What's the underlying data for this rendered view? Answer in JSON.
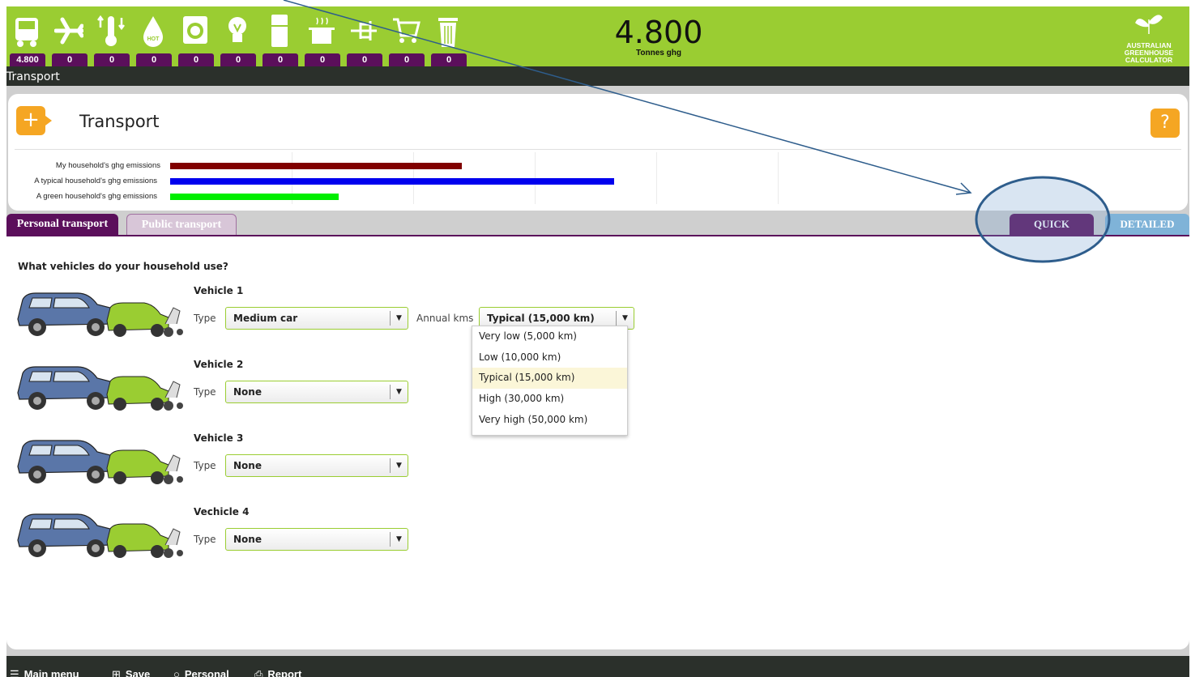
{
  "header": {
    "categories": [
      {
        "name": "transport",
        "value": "4.800"
      },
      {
        "name": "air-travel",
        "value": "0"
      },
      {
        "name": "heating-cooling",
        "value": "0"
      },
      {
        "name": "hot-water",
        "value": "0"
      },
      {
        "name": "laundry",
        "value": "0"
      },
      {
        "name": "lighting",
        "value": "0"
      },
      {
        "name": "fridge",
        "value": "0"
      },
      {
        "name": "cooking",
        "value": "0"
      },
      {
        "name": "appliances",
        "value": "0"
      },
      {
        "name": "shopping",
        "value": "0"
      },
      {
        "name": "waste",
        "value": "0"
      }
    ],
    "total_value": "4.800",
    "total_unit": "Tonnes ghg",
    "logo_text_1": "AUSTRALIAN",
    "logo_text_2": "GREENHOUSE",
    "logo_text_3": "CALCULATOR",
    "breadcrumb": "Transport"
  },
  "panel": {
    "title": "Transport",
    "plus_symbol": "+",
    "help_symbol": "?",
    "bars": [
      {
        "label": "My household's ghg emissions",
        "value": 0.45,
        "color": "#800000"
      },
      {
        "label": "A typical household's ghg emissions",
        "value": 0.685,
        "color": "#0000ee"
      },
      {
        "label": "A green household's ghg emissions",
        "value": 0.26,
        "color": "#00ee00"
      }
    ]
  },
  "tabs": {
    "personal": "Personal transport",
    "public": "Public transport",
    "quick": "QUICK",
    "detailed": "DETAILED"
  },
  "content": {
    "question": "What vehicles do your household use?",
    "type_label": "Type",
    "kms_label": "Annual kms",
    "vehicles": [
      {
        "title": "Vehicle 1",
        "type": "Medium car",
        "kms": "Typical (15,000 km)"
      },
      {
        "title": "Vehicle 2",
        "type": "None"
      },
      {
        "title": "Vehicle 3",
        "type": "None"
      },
      {
        "title": "Vechicle 4",
        "type": "None"
      }
    ],
    "kms_options": [
      "Very low (5,000 km)",
      "Low (10,000 km)",
      "Typical (15,000 km)",
      "High (30,000 km)",
      "Very high (50,000 km)"
    ],
    "kms_selected_index": 2
  },
  "footer": {
    "main_menu": "Main menu",
    "save": "Save",
    "personal": "Personal",
    "report": "Report"
  },
  "colors": {
    "header_green": "#9acd32",
    "accent_purple": "#5b0f5b",
    "orange": "#f5a623",
    "annotation_blue": "#2e5d8c"
  }
}
